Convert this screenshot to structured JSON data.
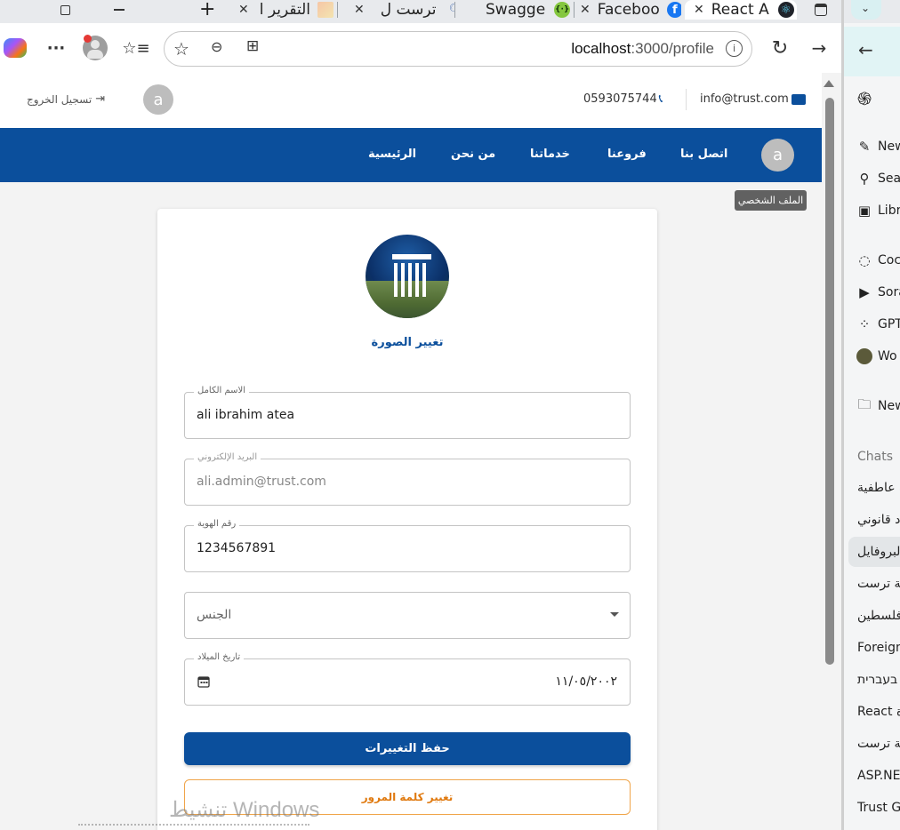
{
  "browser": {
    "tabs": [
      {
        "title": "التقرير ا",
        "favicon": "document-icon"
      },
      {
        "title": "ترست ل",
        "favicon": "search-icon"
      },
      {
        "title": "Swagge",
        "favicon": "swagger-icon"
      },
      {
        "title": "Faceboo",
        "favicon": "facebook-icon"
      },
      {
        "title": "React A",
        "favicon": "react-icon"
      }
    ],
    "address": {
      "host": "localhost",
      "path": ":3000/profile"
    }
  },
  "topbar": {
    "logout_label": "تسجيل الخروج",
    "avatar_letter": "a",
    "phone": "0593075744",
    "email": "info@trust.com"
  },
  "navbar": {
    "items": [
      "اتصل بنا",
      "فروعنا",
      "خدماتنا",
      "من نحن",
      "الرئيسية"
    ],
    "avatar_letter": "a",
    "tooltip": "الملف الشخصي"
  },
  "profile": {
    "change_photo_label": "تغيير الصورة",
    "fields": [
      {
        "label": "الاسم الكامل",
        "value": "ali ibrahim atea"
      },
      {
        "label": "البريد الإلكتروني",
        "value": "ali.admin@trust.com"
      },
      {
        "label": "رقم الهوية",
        "value": "1234567891"
      },
      {
        "placeholder": "الجنس"
      },
      {
        "label": "تاريخ الميلاد",
        "value": "١١/٠٥/٢٠٠٢"
      }
    ],
    "save_label": "حفظ التغييرات",
    "change_password_label": "تغيير كلمة المرور"
  },
  "watermark": "تنشيط Windows",
  "sidebar": {
    "items": [
      "New",
      "Sea",
      "Libr",
      "Coc",
      "Sora",
      "GPT",
      "Wo",
      "New"
    ],
    "section": "Chats",
    "chats": [
      "ة عاطفية",
      "د قانوني",
      "البروفايل",
      "كة ترست",
      "فلسطين",
      "Foreign",
      "בעברית",
      "React ة",
      "كة ترست",
      "ASP.NET",
      "Trust Gr"
    ]
  },
  "colors": {
    "brand": "#0b4f9c",
    "accent_orange": "#e07a10"
  }
}
